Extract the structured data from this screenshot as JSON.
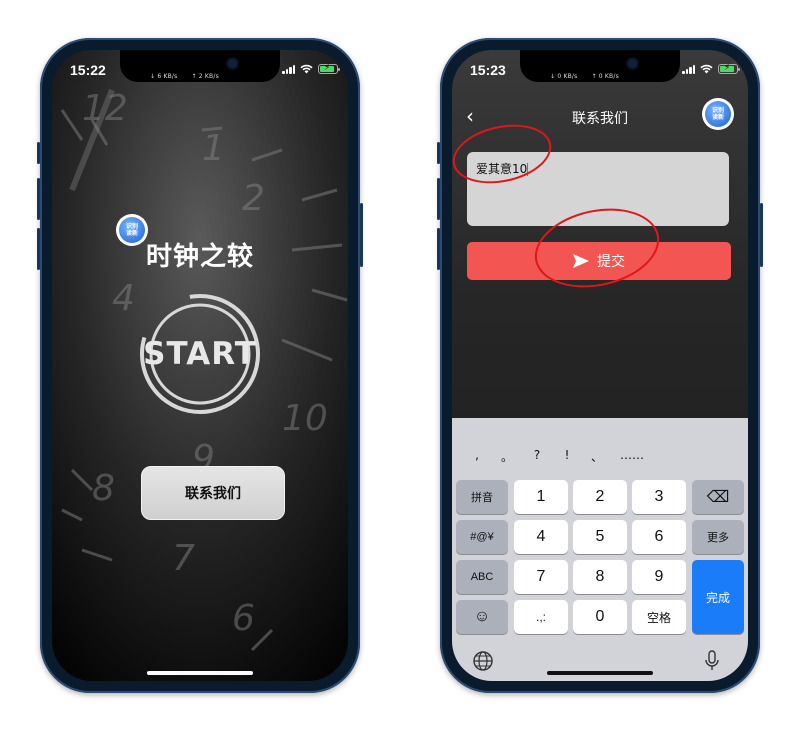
{
  "left_phone": {
    "status": {
      "time": "15:22",
      "down": "↓ 6 KB/s",
      "up": "↑ 2 KB/s"
    },
    "badge": {
      "line1": "识别",
      "line2": "读新"
    },
    "title": "时钟之较",
    "start_label": "START",
    "contact_button": "联系我们"
  },
  "right_phone": {
    "status": {
      "time": "15:23",
      "down": "↓ 0 KB/s",
      "up": "↑ 0 KB/s"
    },
    "nav": {
      "back": "‹",
      "title": "联系我们"
    },
    "badge": {
      "line1": "识别",
      "line2": "读新"
    },
    "message_input": {
      "value": "爱其意10"
    },
    "submit_button": "提交",
    "keyboard": {
      "punctuation": [
        ",",
        "。",
        "?",
        "!",
        "、",
        "……"
      ],
      "keys": {
        "pinyin": "拼音",
        "symbols": "#@¥",
        "abc": "ABC",
        "emoji": "☺",
        "k1": "1",
        "k2": "2",
        "k3": "3",
        "k4": "4",
        "k5": "5",
        "k6": "6",
        "k7": "7",
        "k8": "8",
        "k9": "9",
        "punct": ".,:",
        "k0": "0",
        "space": "空格",
        "delete": "⌫",
        "more": "更多",
        "done": "完成"
      }
    }
  }
}
